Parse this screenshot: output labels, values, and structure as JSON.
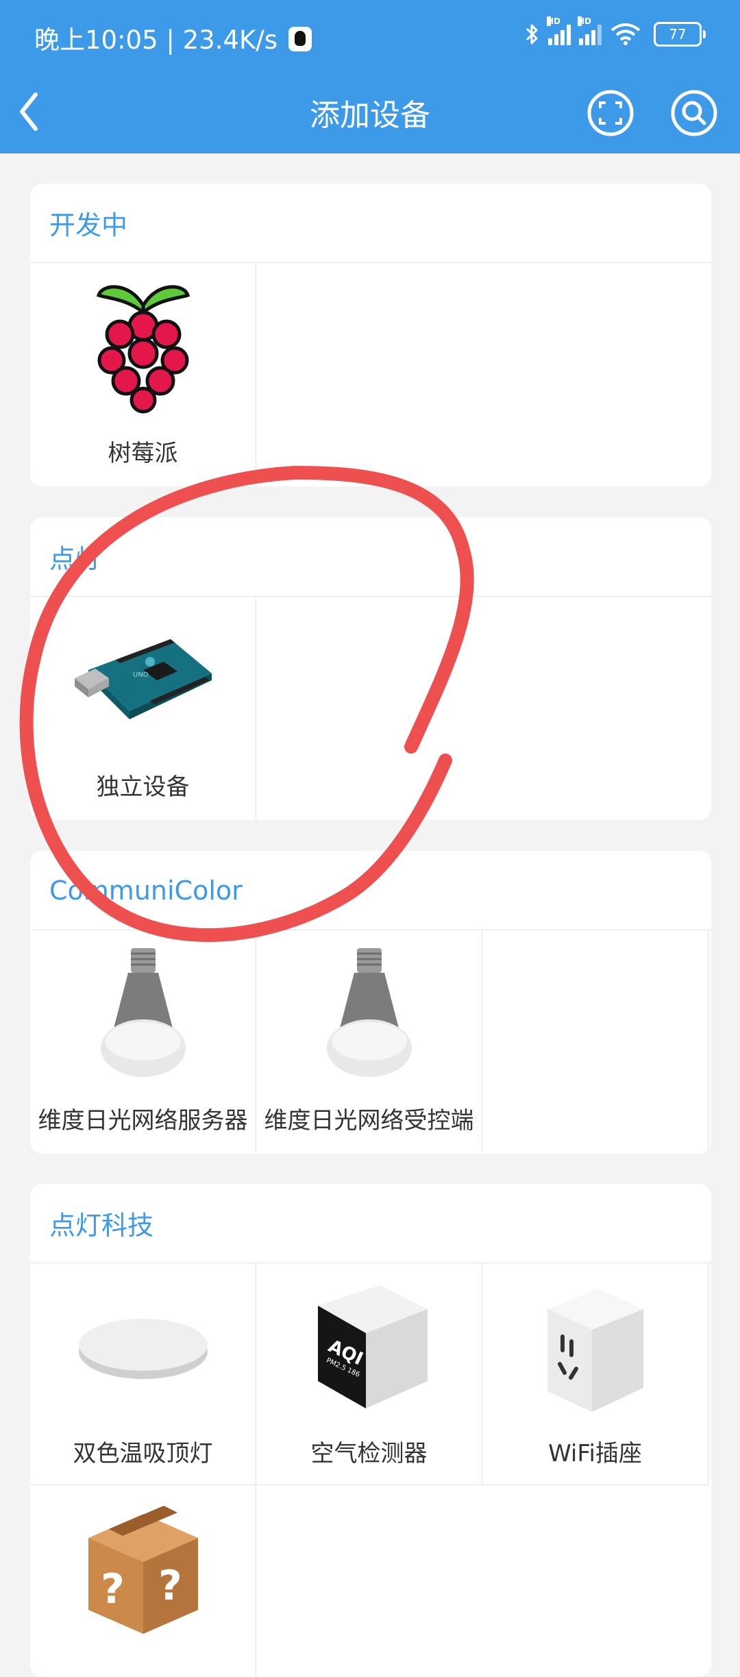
{
  "status_bar": {
    "time_speed": "晚上10:05 | 23.4K/s",
    "signal_tag_1": "HD",
    "signal_tag_2": "HD",
    "battery": "77"
  },
  "nav": {
    "title": "添加设备",
    "back_icon": "chevron-left-icon",
    "scan_icon": "scan-icon",
    "search_icon": "search-icon"
  },
  "sections": [
    {
      "title": "开发中",
      "items": [
        {
          "label": "树莓派",
          "icon": "raspberry-pi-icon"
        }
      ]
    },
    {
      "title": "点灯",
      "items": [
        {
          "label": "独立设备",
          "icon": "arduino-board-icon"
        }
      ]
    },
    {
      "title": "CommuniColor",
      "items": [
        {
          "label": "维度日光网络服务器",
          "icon": "light-bulb-icon"
        },
        {
          "label": "维度日光网络受控端",
          "icon": "light-bulb-icon"
        }
      ]
    },
    {
      "title": "点灯科技",
      "items": [
        {
          "label": "双色温吸顶灯",
          "icon": "ceiling-light-icon"
        },
        {
          "label": "空气检测器",
          "icon": "air-quality-monitor-icon",
          "screen_text": "AQI",
          "screen_subtext": "PM2.5 186"
        },
        {
          "label": "WiFi插座",
          "icon": "wifi-socket-icon"
        },
        {
          "label": "",
          "icon": "unknown-box-icon"
        }
      ]
    }
  ],
  "colors": {
    "accent": "#3d9ae8",
    "annotation": "#ee4f4f",
    "background": "#f3f3f3"
  }
}
